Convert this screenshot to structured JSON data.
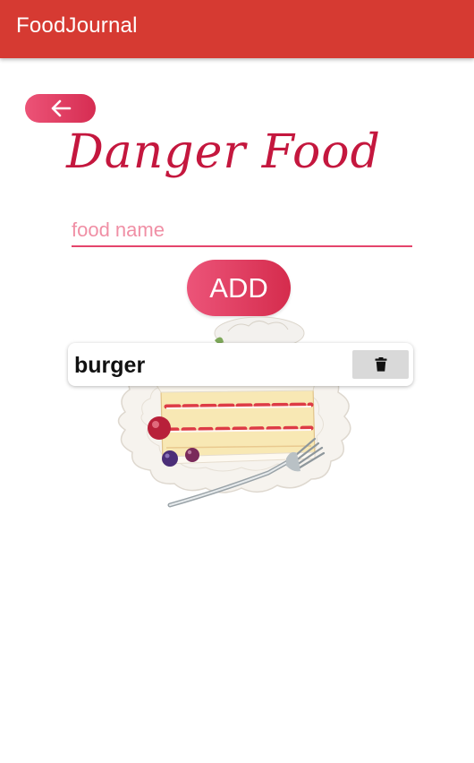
{
  "app_bar": {
    "title": "FoodJournal",
    "color": "#d63a32"
  },
  "back_button": {
    "icon": "arrow-left-icon"
  },
  "page": {
    "title": "Danger Food",
    "title_color": "#c4173e"
  },
  "food_input": {
    "placeholder": "food name",
    "value": ""
  },
  "add_button": {
    "label": "ADD",
    "color": "#e0405f"
  },
  "food_list": [
    {
      "name": "burger",
      "delete_icon": "trash-icon"
    }
  ],
  "illustration": {
    "icon": "cake-slice-illustration"
  }
}
